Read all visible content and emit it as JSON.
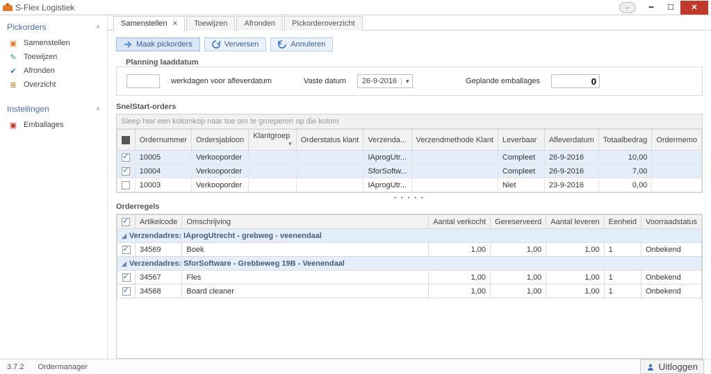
{
  "app": {
    "title": "S-Flex Logistiek"
  },
  "sidebar": {
    "sections": [
      {
        "title": "Pickorders",
        "items": [
          {
            "label": "Samenstellen"
          },
          {
            "label": "Toewijzen"
          },
          {
            "label": "Afronden"
          },
          {
            "label": "Overzicht"
          }
        ]
      },
      {
        "title": "Instellingen",
        "items": [
          {
            "label": "Emballages"
          }
        ]
      }
    ]
  },
  "tabs": [
    {
      "label": "Samenstellen",
      "active": true,
      "closable": true
    },
    {
      "label": "Toewijzen"
    },
    {
      "label": "Afronden"
    },
    {
      "label": "Pickorderoverzicht"
    }
  ],
  "toolbar": {
    "make": "Maak pickorders",
    "refresh": "Verversen",
    "cancel": "Annuleren"
  },
  "planning": {
    "title": "Planning laaddatum",
    "days_value": "",
    "days_label": "werkdagen voor afleverdatum",
    "fixed_label": "Vaste datum",
    "fixed_value": "26-9-2016",
    "planned_label": "Geplande emballages",
    "planned_value": "0"
  },
  "orders": {
    "title": "SnelStart-orders",
    "group_hint": "Sleep hier een kolomkop naar toe om te groeperen op die kolom",
    "columns": [
      "Ordernummer",
      "Ordersjabloon",
      "Klantgroep",
      "Orderstatus klant",
      "Verzenda...",
      "Verzendmethode Klant",
      "Leverbaar",
      "Afleverdatum",
      "Totaalbedrag",
      "Ordermemo"
    ],
    "rows": [
      {
        "checked": true,
        "cells": [
          "10005",
          "Verkooporder",
          "",
          "",
          "IAprogUtr...",
          "",
          "Compleet",
          "26-9-2016",
          "10,00",
          ""
        ]
      },
      {
        "checked": true,
        "cells": [
          "10004",
          "Verkooporder",
          "",
          "",
          "SforSoftw...",
          "",
          "Compleet",
          "26-9-2016",
          "7,00",
          ""
        ]
      },
      {
        "checked": false,
        "cells": [
          "10003",
          "Verkooporder",
          "",
          "",
          "IAprogUtr...",
          "",
          "Niet",
          "23-9-2016",
          "0,00",
          ""
        ]
      }
    ]
  },
  "lines": {
    "title": "Orderregels",
    "columns": [
      "Artikelcode",
      "Omschrijving",
      "Aantal verkocht",
      "Gereserveerd",
      "Aantal leveren",
      "Eenheid",
      "Voorraadstatus"
    ],
    "groups": [
      {
        "header": "Verzendadres: IAprogUtrecht - grebweg - veenendaal",
        "rows": [
          {
            "checked": true,
            "cells": [
              "34569",
              "Boek",
              "1,00",
              "1,00",
              "1,00",
              "1",
              "Onbekend"
            ]
          }
        ]
      },
      {
        "header": "Verzendadres: SforSoftware - Grebbeweg 19B - Veenendaal",
        "rows": [
          {
            "checked": true,
            "cells": [
              "34567",
              "Fles",
              "1,00",
              "1,00",
              "1,00",
              "1",
              "Onbekend"
            ]
          },
          {
            "checked": true,
            "cells": [
              "34568",
              "Board cleaner",
              "1,00",
              "1,00",
              "1,00",
              "1",
              "Onbekend"
            ]
          }
        ]
      }
    ]
  },
  "status": {
    "version": "3.7.2",
    "module": "Ordermanager",
    "logout": "Uitloggen"
  }
}
